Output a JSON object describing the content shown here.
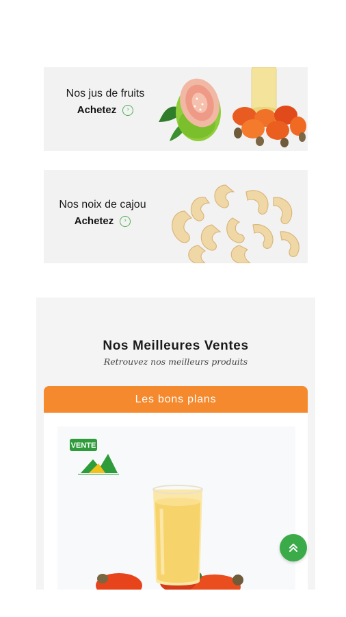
{
  "banners": [
    {
      "title": "Nos jus de fruits",
      "cta": "Achetez",
      "cta_icon": "circle-arrow-icon",
      "image": "guava-juice-cashew-apples"
    },
    {
      "title": "Nos noix de cajou",
      "cta": "Achetez",
      "cta_icon": "circle-arrow-icon",
      "image": "cashew-nuts-pile"
    }
  ],
  "best_sellers": {
    "title": "Nos Meilleures Ventes",
    "subtitle": "Retrouvez nos meilleurs produits",
    "tab_label": "Les bons plans",
    "product": {
      "badge_text": "VENTE",
      "image": "cashew-apple-juice-glass"
    }
  },
  "scroll_top": {
    "icon": "double-chevron-up-icon",
    "color": "#3bab4a"
  },
  "colors": {
    "accent": "#f4892d",
    "green": "#4caf50",
    "panel_bg": "#f2f2f2"
  }
}
